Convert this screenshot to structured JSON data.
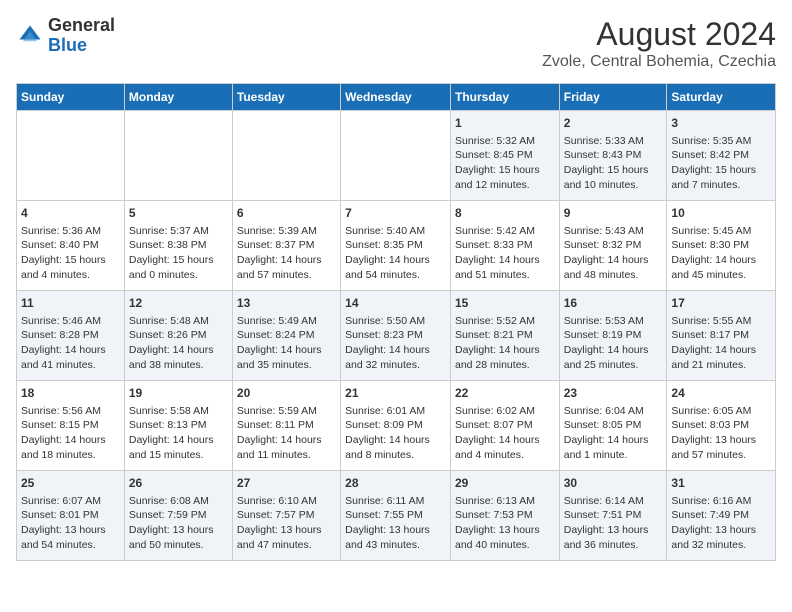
{
  "header": {
    "logo_general": "General",
    "logo_blue": "Blue",
    "month_year": "August 2024",
    "location": "Zvole, Central Bohemia, Czechia"
  },
  "weekdays": [
    "Sunday",
    "Monday",
    "Tuesday",
    "Wednesday",
    "Thursday",
    "Friday",
    "Saturday"
  ],
  "weeks": [
    [
      {
        "day": "",
        "info": ""
      },
      {
        "day": "",
        "info": ""
      },
      {
        "day": "",
        "info": ""
      },
      {
        "day": "",
        "info": ""
      },
      {
        "day": "1",
        "info": "Sunrise: 5:32 AM\nSunset: 8:45 PM\nDaylight: 15 hours and 12 minutes."
      },
      {
        "day": "2",
        "info": "Sunrise: 5:33 AM\nSunset: 8:43 PM\nDaylight: 15 hours and 10 minutes."
      },
      {
        "day": "3",
        "info": "Sunrise: 5:35 AM\nSunset: 8:42 PM\nDaylight: 15 hours and 7 minutes."
      }
    ],
    [
      {
        "day": "4",
        "info": "Sunrise: 5:36 AM\nSunset: 8:40 PM\nDaylight: 15 hours and 4 minutes."
      },
      {
        "day": "5",
        "info": "Sunrise: 5:37 AM\nSunset: 8:38 PM\nDaylight: 15 hours and 0 minutes."
      },
      {
        "day": "6",
        "info": "Sunrise: 5:39 AM\nSunset: 8:37 PM\nDaylight: 14 hours and 57 minutes."
      },
      {
        "day": "7",
        "info": "Sunrise: 5:40 AM\nSunset: 8:35 PM\nDaylight: 14 hours and 54 minutes."
      },
      {
        "day": "8",
        "info": "Sunrise: 5:42 AM\nSunset: 8:33 PM\nDaylight: 14 hours and 51 minutes."
      },
      {
        "day": "9",
        "info": "Sunrise: 5:43 AM\nSunset: 8:32 PM\nDaylight: 14 hours and 48 minutes."
      },
      {
        "day": "10",
        "info": "Sunrise: 5:45 AM\nSunset: 8:30 PM\nDaylight: 14 hours and 45 minutes."
      }
    ],
    [
      {
        "day": "11",
        "info": "Sunrise: 5:46 AM\nSunset: 8:28 PM\nDaylight: 14 hours and 41 minutes."
      },
      {
        "day": "12",
        "info": "Sunrise: 5:48 AM\nSunset: 8:26 PM\nDaylight: 14 hours and 38 minutes."
      },
      {
        "day": "13",
        "info": "Sunrise: 5:49 AM\nSunset: 8:24 PM\nDaylight: 14 hours and 35 minutes."
      },
      {
        "day": "14",
        "info": "Sunrise: 5:50 AM\nSunset: 8:23 PM\nDaylight: 14 hours and 32 minutes."
      },
      {
        "day": "15",
        "info": "Sunrise: 5:52 AM\nSunset: 8:21 PM\nDaylight: 14 hours and 28 minutes."
      },
      {
        "day": "16",
        "info": "Sunrise: 5:53 AM\nSunset: 8:19 PM\nDaylight: 14 hours and 25 minutes."
      },
      {
        "day": "17",
        "info": "Sunrise: 5:55 AM\nSunset: 8:17 PM\nDaylight: 14 hours and 21 minutes."
      }
    ],
    [
      {
        "day": "18",
        "info": "Sunrise: 5:56 AM\nSunset: 8:15 PM\nDaylight: 14 hours and 18 minutes."
      },
      {
        "day": "19",
        "info": "Sunrise: 5:58 AM\nSunset: 8:13 PM\nDaylight: 14 hours and 15 minutes."
      },
      {
        "day": "20",
        "info": "Sunrise: 5:59 AM\nSunset: 8:11 PM\nDaylight: 14 hours and 11 minutes."
      },
      {
        "day": "21",
        "info": "Sunrise: 6:01 AM\nSunset: 8:09 PM\nDaylight: 14 hours and 8 minutes."
      },
      {
        "day": "22",
        "info": "Sunrise: 6:02 AM\nSunset: 8:07 PM\nDaylight: 14 hours and 4 minutes."
      },
      {
        "day": "23",
        "info": "Sunrise: 6:04 AM\nSunset: 8:05 PM\nDaylight: 14 hours and 1 minute."
      },
      {
        "day": "24",
        "info": "Sunrise: 6:05 AM\nSunset: 8:03 PM\nDaylight: 13 hours and 57 minutes."
      }
    ],
    [
      {
        "day": "25",
        "info": "Sunrise: 6:07 AM\nSunset: 8:01 PM\nDaylight: 13 hours and 54 minutes."
      },
      {
        "day": "26",
        "info": "Sunrise: 6:08 AM\nSunset: 7:59 PM\nDaylight: 13 hours and 50 minutes."
      },
      {
        "day": "27",
        "info": "Sunrise: 6:10 AM\nSunset: 7:57 PM\nDaylight: 13 hours and 47 minutes."
      },
      {
        "day": "28",
        "info": "Sunrise: 6:11 AM\nSunset: 7:55 PM\nDaylight: 13 hours and 43 minutes."
      },
      {
        "day": "29",
        "info": "Sunrise: 6:13 AM\nSunset: 7:53 PM\nDaylight: 13 hours and 40 minutes."
      },
      {
        "day": "30",
        "info": "Sunrise: 6:14 AM\nSunset: 7:51 PM\nDaylight: 13 hours and 36 minutes."
      },
      {
        "day": "31",
        "info": "Sunrise: 6:16 AM\nSunset: 7:49 PM\nDaylight: 13 hours and 32 minutes."
      }
    ]
  ]
}
